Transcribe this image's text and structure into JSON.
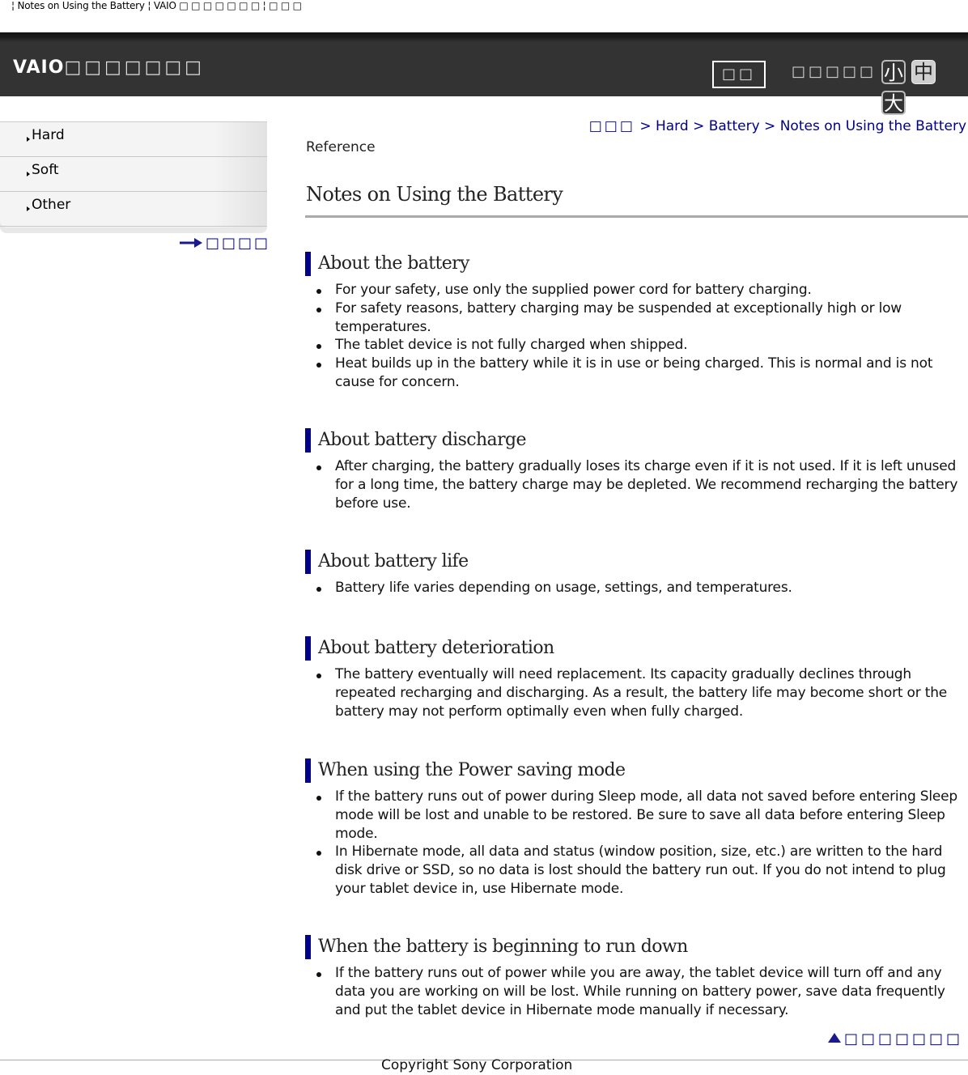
{
  "browser": {
    "tab_title": "¦ Notes on Using the Battery ¦ VAIO □ □ □ □ □ □ □ ¦ □ □ □"
  },
  "header": {
    "brand_latin": "VAIO",
    "brand_cjk": "□□□□□□□",
    "search_button": "□□",
    "font_size_label": "□□□□□",
    "font_sizes": {
      "small": "小",
      "medium": "中",
      "large": "大",
      "selected": "medium"
    }
  },
  "sidebar": {
    "items": [
      {
        "label": "Hard"
      },
      {
        "label": "Soft"
      },
      {
        "label": "Other"
      }
    ],
    "link_label": "□□□□"
  },
  "breadcrumb": {
    "home": "□□□",
    "items": [
      "Hard",
      "Battery",
      "Notes on Using the Battery"
    ],
    "separator": ">"
  },
  "page": {
    "category": "Reference",
    "title": "Notes on Using the Battery",
    "accent_color": "#00008b",
    "sections": [
      {
        "heading": "About the battery",
        "bullets": [
          "For your safety, use only the supplied power cord for battery charging.",
          "For safety reasons, battery charging may be suspended at exceptionally high or low temperatures.",
          "The tablet device is not fully charged when shipped.",
          "Heat builds up in the battery while it is in use or being charged. This is normal and is not cause for concern."
        ]
      },
      {
        "heading": "About battery discharge",
        "bullets": [
          "After charging, the battery gradually loses its charge even if it is not used. If it is left unused for a long time, the battery charge may be depleted. We recommend recharging the battery before use."
        ]
      },
      {
        "heading": "About battery life",
        "bullets": [
          "Battery life varies depending on usage, settings, and temperatures."
        ]
      },
      {
        "heading": "About battery deterioration",
        "bullets": [
          "The battery eventually will need replacement. Its capacity gradually declines through repeated recharging and discharging. As a result, the battery life may become short or the battery may not perform optimally even when fully charged."
        ]
      },
      {
        "heading": "When using the Power saving mode",
        "bullets": [
          "If the battery runs out of power during Sleep mode, all data not saved before entering Sleep mode will be lost and unable to be restored. Be sure to save all data before entering Sleep mode.",
          "In Hibernate mode, all data and status (window position, size, etc.) are written to the hard disk drive or SSD, so no data is lost should the battery run out. If you do not intend to plug your tablet device in, use Hibernate mode."
        ]
      },
      {
        "heading": "When the battery is beginning to run down",
        "bullets": [
          "If the battery runs out of power while you are away, the tablet device will turn off and any data you are working on will be lost. While running on battery power, save data frequently and put the tablet device in Hibernate mode manually if necessary."
        ]
      }
    ]
  },
  "footer": {
    "back_to_top": "□□□□□□□",
    "copyright": "Copyright Sony Corporation"
  }
}
